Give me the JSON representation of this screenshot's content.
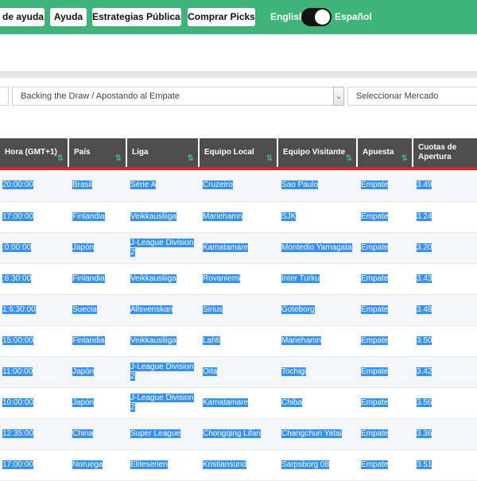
{
  "header": {
    "buttons": [
      {
        "label": "a de ayuda"
      },
      {
        "label": "Ayuda"
      },
      {
        "label": "Estrategias Públicas"
      },
      {
        "label": "Comprar Picks"
      }
    ],
    "lang_left": "English",
    "lang_right": "Español"
  },
  "filters": {
    "left_value": "",
    "strategy": "Backing the Draw / Apostando al Empate",
    "market": "Seleccionar Mercado"
  },
  "table": {
    "columns": [
      "Hora (GMT+1)",
      "País",
      "Liga",
      "Equipo Local",
      "Equipo Visitante",
      "Apuesta",
      "Cuotas de Apertura"
    ],
    "rows": [
      [
        "20:00:00",
        "Brasil",
        "Série A",
        "Cruzeiro",
        "Sao Paulo",
        "Empate",
        "3.49"
      ],
      [
        "17:00:00",
        "Finlandia",
        "Veikkausliiga",
        "Mariehamn",
        "SJK",
        "Empate",
        "3.24"
      ],
      [
        ":0:00:00",
        "Japón",
        "J-League Division 2",
        "Kamatamare",
        "Montedio Yamagata",
        "Empate",
        "3.20"
      ],
      [
        ":6:30:00",
        "Finlandia",
        "Veikkausliiga",
        "Rovaniemi",
        "Inter Turku",
        "Empate",
        "3.43"
      ],
      [
        "1:6:30:00",
        "Suecia",
        "Allsvenskan",
        "Sirius",
        "Goteborg",
        "Empate",
        "3.48"
      ],
      [
        "15:00:00",
        "Finlandia",
        "Veikkausliiga",
        "Lahti",
        "Mariehamn",
        "Empate",
        "3.50"
      ],
      [
        "11:00:00",
        "Japón",
        "J-League Division 2",
        "Oita",
        "Tochigi",
        "Empate",
        "3.42"
      ],
      [
        "10:00:00",
        "Japón",
        "J-League Division 2",
        "Kamatamare",
        "Chiba",
        "Empate",
        "3.56"
      ],
      [
        "12:35:00",
        "China",
        "Super League",
        "Chongqing Lifan",
        "Changchun Yatai",
        "Empate",
        "3.36"
      ],
      [
        "17:00:00",
        "Noruega",
        "Eliteserien",
        "Kristiansund",
        "Sarpsborg 08",
        "Empate",
        "3.51"
      ]
    ]
  },
  "icons": {
    "sort": "⇅",
    "chevron": "⌄"
  },
  "colors": {
    "header_green": "#3fb47a",
    "selection_blue": "#3390ff",
    "th_bg": "#4d4d4d",
    "accent_red": "#e02020"
  }
}
